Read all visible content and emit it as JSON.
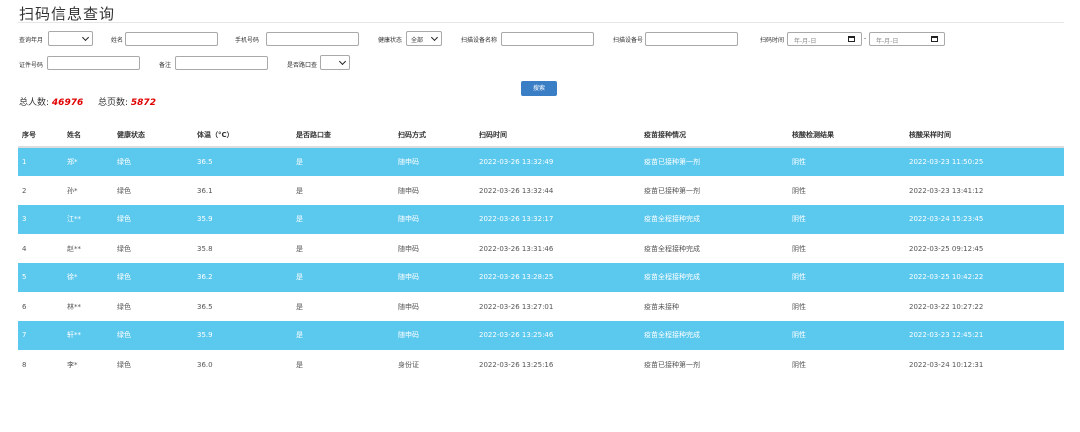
{
  "title": "扫码信息查询",
  "filters": {
    "month_label": "查询年月",
    "name_label": "姓名",
    "phone_label": "手机号码",
    "health_label": "健康状态",
    "health_value": "全部",
    "device_name_label": "扫描设备名称",
    "device_no_label": "扫描设备号",
    "scan_time_label": "扫码时间",
    "date_placeholder": "年-月-日",
    "date_separator": "-",
    "id_label": "证件号码",
    "remark_label": "备注",
    "gate_label": "是否路口查"
  },
  "search_button": "搜索",
  "summary": {
    "total_people_label": "总人数:",
    "total_people": "46976",
    "total_pages_label": "总页数:",
    "total_pages": "5872"
  },
  "table": {
    "headers": [
      "序号",
      "姓名",
      "健康状态",
      "体温（°C）",
      "是否路口查",
      "扫码方式",
      "扫码时间",
      "疫苗接种情况",
      "核酸检测结果",
      "核酸采样时间"
    ],
    "rows": [
      [
        "1",
        "郑*",
        "绿色",
        "36.5",
        "是",
        "随申码",
        "2022-03-26 13:32:49",
        "疫苗已接种第一剂",
        "阴性",
        "2022-03-23 11:50:25"
      ],
      [
        "2",
        "孙*",
        "绿色",
        "36.1",
        "是",
        "随申码",
        "2022-03-26 13:32:44",
        "疫苗已接种第一剂",
        "阴性",
        "2022-03-23 13:41:12"
      ],
      [
        "3",
        "江**",
        "绿色",
        "35.9",
        "是",
        "随申码",
        "2022-03-26 13:32:17",
        "疫苗全程接种完成",
        "阴性",
        "2022-03-24 15:23:45"
      ],
      [
        "4",
        "赵**",
        "绿色",
        "35.8",
        "是",
        "随申码",
        "2022-03-26 13:31:46",
        "疫苗全程接种完成",
        "阴性",
        "2022-03-25 09:12:45"
      ],
      [
        "5",
        "徐*",
        "绿色",
        "36.2",
        "是",
        "随申码",
        "2022-03-26 13:28:25",
        "疫苗全程接种完成",
        "阴性",
        "2022-03-25 10:42:22"
      ],
      [
        "6",
        "林**",
        "绿色",
        "36.5",
        "是",
        "随申码",
        "2022-03-26 13:27:01",
        "疫苗未接种",
        "阴性",
        "2022-03-22 10:27:22"
      ],
      [
        "7",
        "轩**",
        "绿色",
        "35.9",
        "是",
        "随申码",
        "2022-03-26 13:25:46",
        "疫苗全程接种完成",
        "阴性",
        "2022-03-23 12:45:21"
      ],
      [
        "8",
        "李*",
        "绿色",
        "36.0",
        "是",
        "身份证",
        "2022-03-26 13:25:16",
        "疫苗已接种第一剂",
        "阴性",
        "2022-03-24 10:12:31"
      ]
    ],
    "highlight_color": "#5bc8ee"
  }
}
